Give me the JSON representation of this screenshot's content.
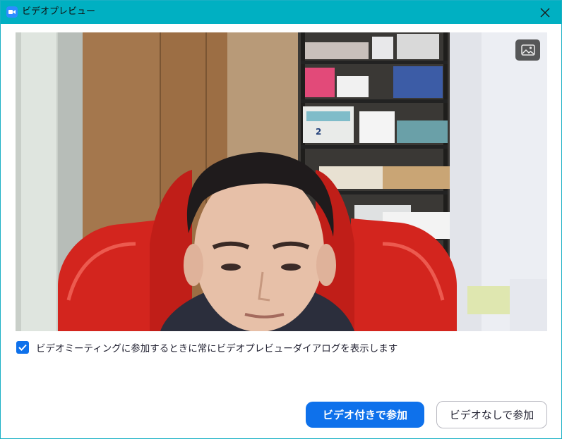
{
  "window": {
    "title": "ビデオプレビュー"
  },
  "preview": {
    "background_toggle_icon": "image-icon",
    "label_box_text": "2"
  },
  "option": {
    "checked": true,
    "label": "ビデオミーティングに参加するときに常にビデオプレビューダイアログを表示します"
  },
  "buttons": {
    "join_with_video": "ビデオ付きで参加",
    "join_without_video": "ビデオなしで参加"
  },
  "colors": {
    "titlebar": "#00b0c2",
    "accent": "#0e71eb"
  }
}
